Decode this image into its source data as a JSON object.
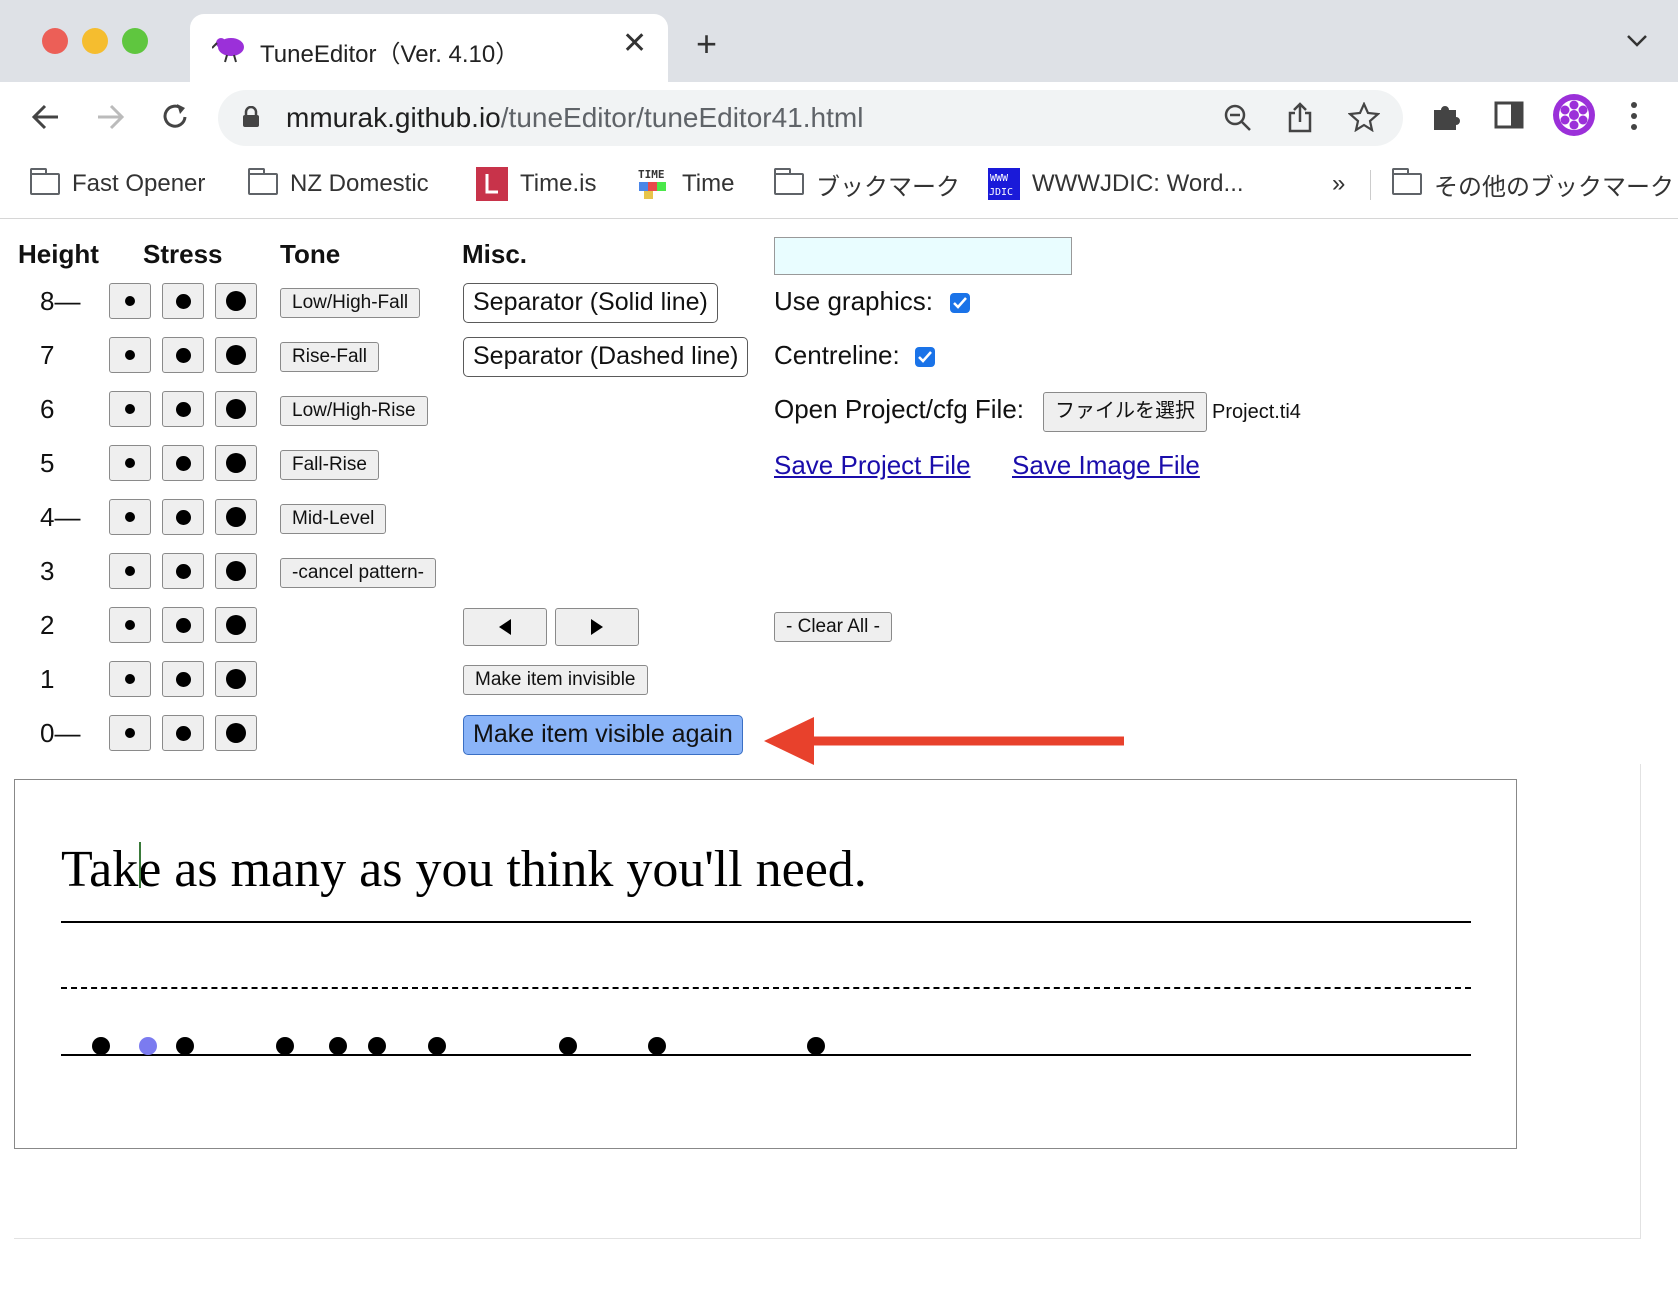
{
  "browser": {
    "tab_title": "TuneEditor（Ver. 4.10）",
    "url_host": "mmurak.github.io",
    "url_path": "/tuneEditor/tuneEditor41.html",
    "bookmarks": [
      {
        "label": "Fast Opener",
        "icon": "folder-icon"
      },
      {
        "label": "NZ Domestic",
        "icon": "folder-icon"
      },
      {
        "label": "Time.is",
        "icon": "timeis-favicon-icon"
      },
      {
        "label": "Time",
        "icon": "time-favicon-icon"
      },
      {
        "label": "ブックマーク",
        "icon": "folder-icon"
      },
      {
        "label": "WWWJDIC: Word...",
        "icon": "wwwjdic-favicon-icon"
      }
    ],
    "overflow": "»",
    "other_bookmarks": "その他のブックマーク",
    "accent": "#1a73e8"
  },
  "editor": {
    "headers": {
      "height": "Height",
      "stress": "Stress",
      "tone": "Tone",
      "misc": "Misc."
    },
    "heights": [
      "8—",
      "7",
      "6",
      "5",
      "4—",
      "3",
      "2",
      "1",
      "0—"
    ],
    "tone_buttons": [
      "Low/High-Fall",
      "Rise-Fall",
      "Low/High-Rise",
      "Fall-Rise",
      "Mid-Level",
      "-cancel pattern-"
    ],
    "misc_buttons": {
      "solid": "Separator (Solid line)",
      "dashed": "Separator (Dashed line)",
      "invisible": "Make item invisible",
      "visible_again": "Make item visible again"
    },
    "text_input_value": "",
    "use_graphics_label": "Use graphics:",
    "use_graphics_checked": true,
    "centreline_label": "Centreline:",
    "centreline_checked": true,
    "open_file_label": "Open Project/cfg File:",
    "file_button": "ファイルを選択",
    "file_name": "Project.ti4",
    "save_project": "Save Project File",
    "save_image": "Save Image File",
    "clear_all": "- Clear All -",
    "highlight_color": "#8ab4f8",
    "annotation_arrow_color": "#e8412c"
  },
  "canvas": {
    "sentence": "Take as many as you think you'll need.",
    "selected_dot_color": "#7b7bf0",
    "dot_color": "#000000",
    "dot_count": 10
  }
}
